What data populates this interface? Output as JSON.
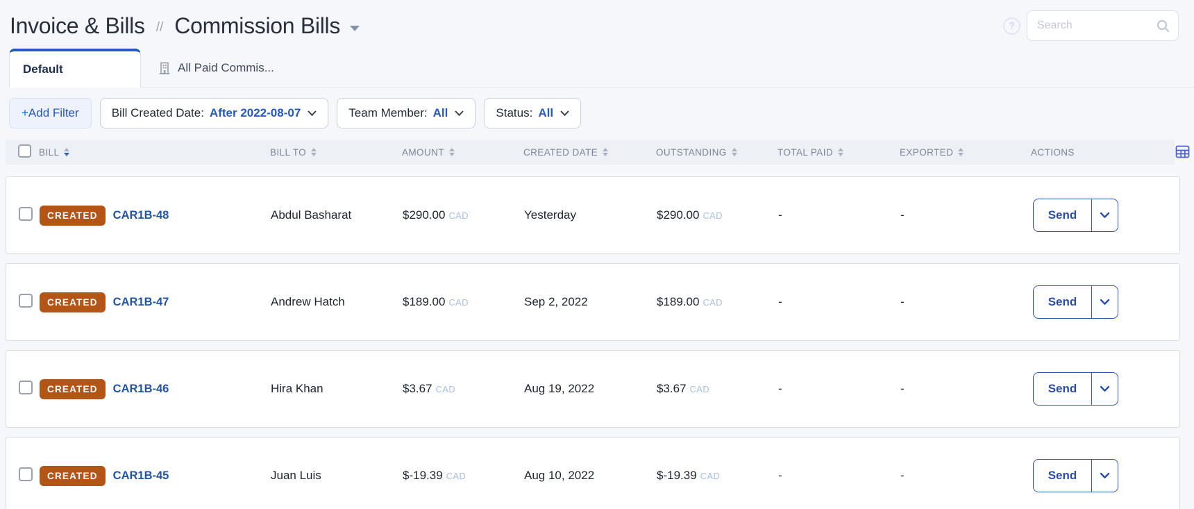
{
  "page": {
    "breadcrumb": {
      "section": "Invoice & Bills",
      "separator": "//",
      "current": "Commission Bills"
    },
    "help_label": "?",
    "search": {
      "placeholder": "Search"
    },
    "tabs": [
      {
        "label": "Default",
        "active": true
      },
      {
        "label": "All Paid Commis...",
        "active": false,
        "icon": "building-icon"
      }
    ],
    "filters": {
      "add_label": "+Add Filter",
      "pills": [
        {
          "label": "Bill Created Date:",
          "value": "After 2022-08-07"
        },
        {
          "label": "Team Member:",
          "value": "All"
        },
        {
          "label": "Status:",
          "value": "All"
        }
      ]
    },
    "table": {
      "columns": [
        "BILL",
        "BILL TO",
        "AMOUNT",
        "CREATED DATE",
        "OUTSTANDING",
        "TOTAL PAID",
        "EXPORTED",
        "ACTIONS"
      ],
      "sorted_column": "BILL",
      "sort_direction": "desc",
      "send_label": "Send",
      "rows": [
        {
          "status": "CREATED",
          "id": "CAR1B-48",
          "bill_to": "Abdul Basharat",
          "amount": "$290.00",
          "currency": "CAD",
          "created": "Yesterday",
          "outstanding": "$290.00",
          "total_paid": "-",
          "exported": "-"
        },
        {
          "status": "CREATED",
          "id": "CAR1B-47",
          "bill_to": "Andrew Hatch",
          "amount": "$189.00",
          "currency": "CAD",
          "created": "Sep 2, 2022",
          "outstanding": "$189.00",
          "total_paid": "-",
          "exported": "-"
        },
        {
          "status": "CREATED",
          "id": "CAR1B-46",
          "bill_to": "Hira Khan",
          "amount": "$3.67",
          "currency": "CAD",
          "created": "Aug 19, 2022",
          "outstanding": "$3.67",
          "total_paid": "-",
          "exported": "-"
        },
        {
          "status": "CREATED",
          "id": "CAR1B-45",
          "bill_to": "Juan Luis",
          "amount": "$-19.39",
          "currency": "CAD",
          "created": "Aug 10, 2022",
          "outstanding": "$-19.39",
          "total_paid": "-",
          "exported": "-"
        }
      ]
    },
    "colors": {
      "accent": "#2458c5",
      "badge_created": "#b45518",
      "link": "#2255a4",
      "currency_label": "#a9bee6",
      "header_bg": "#edf0f4"
    }
  }
}
